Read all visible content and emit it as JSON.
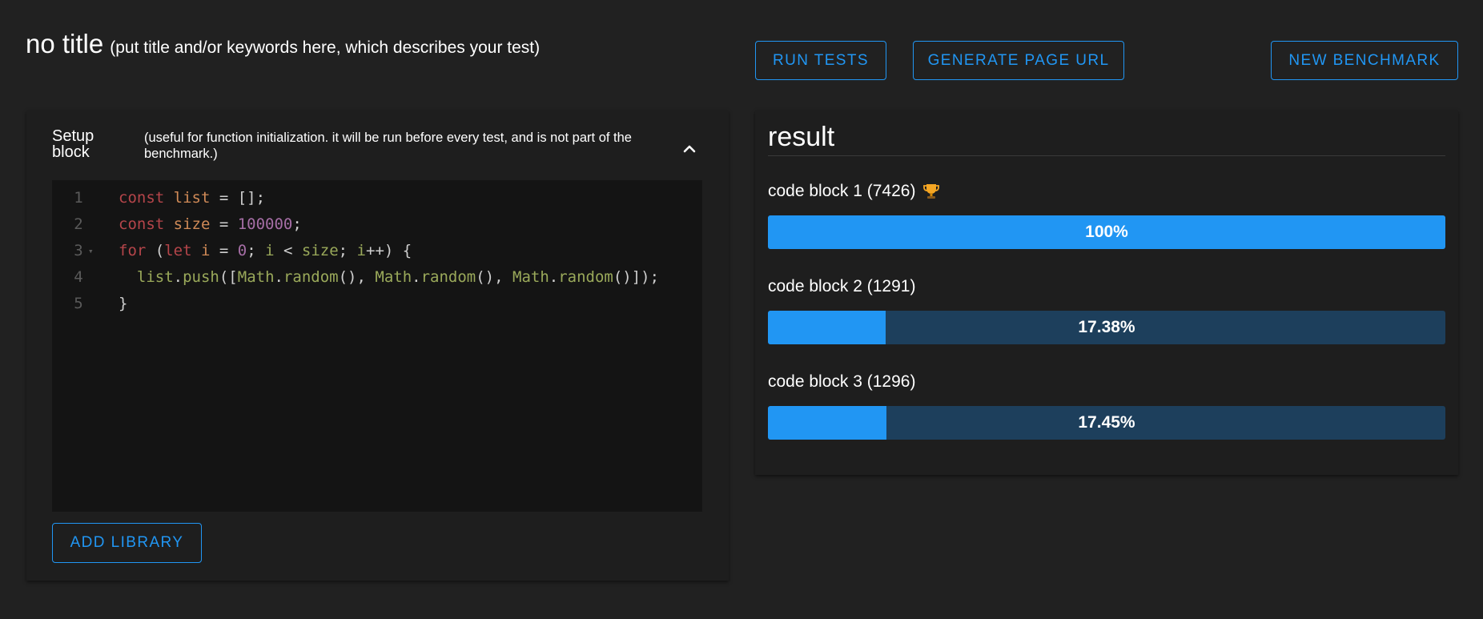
{
  "header": {
    "title": "no title",
    "title_hint": "(put title and/or keywords here, which describes your test)"
  },
  "toolbar": {
    "run_tests_label": "RUN TESTS",
    "generate_url_label": "GENERATE PAGE URL",
    "new_benchmark_label": "NEW BENCHMARK"
  },
  "setup": {
    "label": "Setup block",
    "description": "(useful for function initialization. it will be run before every test, and is not part of the benchmark.)",
    "toggle_icon": "chevron-up-icon",
    "code_lines": [
      {
        "num": "1",
        "tokens": [
          {
            "t": "const ",
            "k": "kw"
          },
          {
            "t": "list",
            "k": "var"
          },
          {
            "t": " = [];",
            "k": "plain"
          }
        ]
      },
      {
        "num": "2",
        "tokens": [
          {
            "t": "const ",
            "k": "kw"
          },
          {
            "t": "size",
            "k": "var"
          },
          {
            "t": " = ",
            "k": "plain"
          },
          {
            "t": "100000",
            "k": "num"
          },
          {
            "t": ";",
            "k": "plain"
          }
        ]
      },
      {
        "num": "3",
        "fold": true,
        "tokens": [
          {
            "t": "for",
            "k": "kw"
          },
          {
            "t": " (",
            "k": "plain"
          },
          {
            "t": "let",
            "k": "kw"
          },
          {
            "t": " i",
            "k": "var"
          },
          {
            "t": " = ",
            "k": "plain"
          },
          {
            "t": "0",
            "k": "num"
          },
          {
            "t": "; ",
            "k": "plain"
          },
          {
            "t": "i",
            "k": "fn"
          },
          {
            "t": " < ",
            "k": "plain"
          },
          {
            "t": "size",
            "k": "fn"
          },
          {
            "t": "; ",
            "k": "plain"
          },
          {
            "t": "i",
            "k": "fn"
          },
          {
            "t": "++) {",
            "k": "plain"
          }
        ]
      },
      {
        "num": "4",
        "tokens": [
          {
            "t": "  list",
            "k": "fn"
          },
          {
            "t": ".",
            "k": "plain"
          },
          {
            "t": "push",
            "k": "fn"
          },
          {
            "t": "([",
            "k": "plain"
          },
          {
            "t": "Math",
            "k": "fn"
          },
          {
            "t": ".",
            "k": "plain"
          },
          {
            "t": "random",
            "k": "fn"
          },
          {
            "t": "(), ",
            "k": "plain"
          },
          {
            "t": "Math",
            "k": "fn"
          },
          {
            "t": ".",
            "k": "plain"
          },
          {
            "t": "random",
            "k": "fn"
          },
          {
            "t": "(), ",
            "k": "plain"
          },
          {
            "t": "Math",
            "k": "fn"
          },
          {
            "t": ".",
            "k": "plain"
          },
          {
            "t": "random",
            "k": "fn"
          },
          {
            "t": "()]);",
            "k": "plain"
          }
        ]
      },
      {
        "num": "5",
        "tokens": [
          {
            "t": "}",
            "k": "plain"
          }
        ]
      }
    ],
    "add_library_label": "ADD LIBRARY"
  },
  "result": {
    "title": "result",
    "winner_icon": "trophy-icon",
    "items": [
      {
        "label": "code block 1 (7426)",
        "percent_text": "100%",
        "fraction": 1.0,
        "winner": true
      },
      {
        "label": "code block 2 (1291)",
        "percent_text": "17.38%",
        "fraction": 0.1738,
        "winner": false
      },
      {
        "label": "code block 3 (1296)",
        "percent_text": "17.45%",
        "fraction": 0.1745,
        "winner": false
      }
    ]
  },
  "colors": {
    "background": "#212121",
    "panel": "#1e1e1e",
    "editor": "#141414",
    "accent": "#2196f3",
    "bar_track": "#1d3f5c"
  }
}
